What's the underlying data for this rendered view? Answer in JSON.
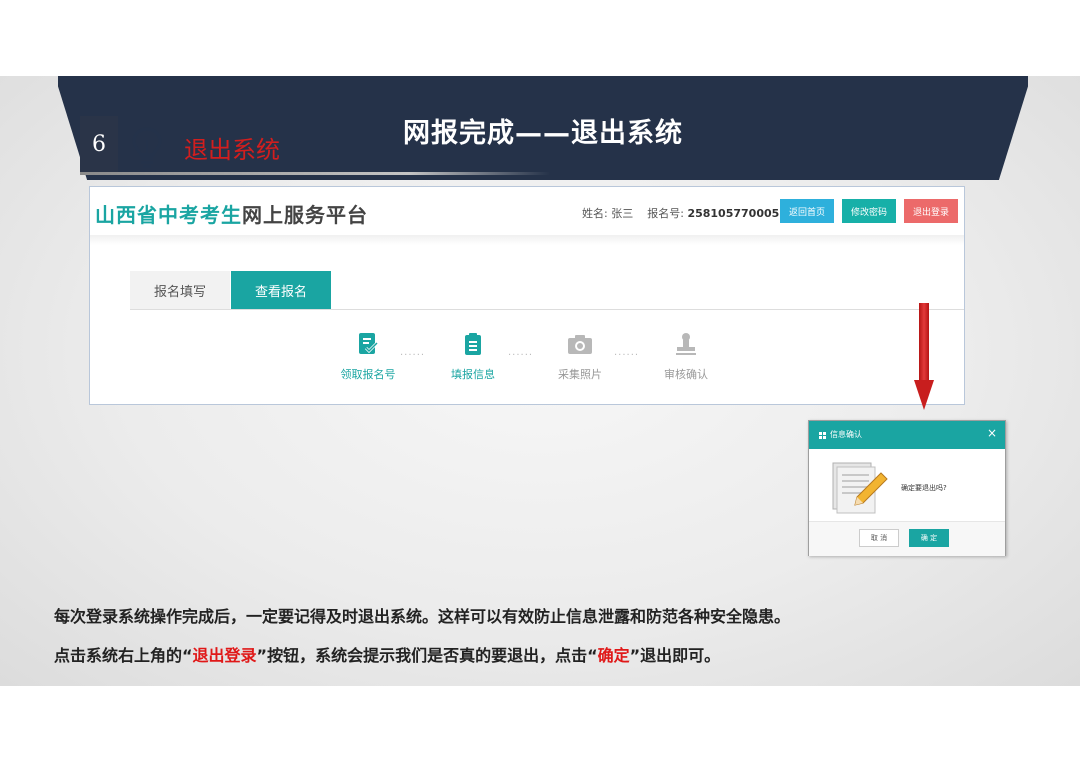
{
  "banner": {
    "title": "网报完成——退出系统"
  },
  "step": {
    "number": "6",
    "title": "退出系统",
    "icon": "lightbulb-icon"
  },
  "screenshot": {
    "site_title_colored": "山西省中考考生",
    "site_title_rest": "网上服务平台",
    "name_label": "姓名:",
    "name_value": "张三",
    "reg_label": "报名号:",
    "reg_value": "258105770005",
    "buttons": {
      "home": "返回首页",
      "password": "修改密码",
      "logout": "退出登录"
    },
    "tabs": [
      "报名填写",
      "查看报名"
    ],
    "progress": {
      "dots": "······",
      "steps": [
        {
          "label": "领取报名号",
          "icon": "document-check-icon",
          "active": true
        },
        {
          "label": "填报信息",
          "icon": "clipboard-icon",
          "active": true
        },
        {
          "label": "采集照片",
          "icon": "camera-icon",
          "active": false
        },
        {
          "label": "审核确认",
          "icon": "stamp-icon",
          "active": false
        }
      ]
    }
  },
  "dialog": {
    "title": "信息确认",
    "close": "×",
    "message": "确定要退出吗?",
    "cancel": "取 消",
    "ok": "确 定"
  },
  "instructions": {
    "line1": "每次登录系统操作完成后，一定要记得及时退出系统。这样可以有效防止信息泄露和防范各种安全隐患。",
    "line2_a": "点击系统右上角的",
    "line2_q1": "“",
    "line2_hl1": "退出登录",
    "line2_q2": "”",
    "line2_b": "按钮，系统会提示我们是否真的要退出，点击",
    "line2_q3": "“",
    "line2_hl2": "确定",
    "line2_q4": "”",
    "line2_c": "退出即可。"
  },
  "colors": {
    "banner": "#253249",
    "accent": "#1aa5a2",
    "highlight": "#e01818",
    "logout": "#ec6a6a"
  }
}
